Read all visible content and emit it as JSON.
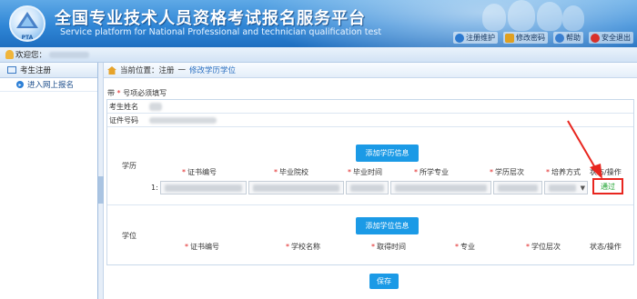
{
  "header": {
    "title_cn": "全国专业技术人员资格考试报名服务平台",
    "title_en": "Service platform for National Professional and technician qualification test",
    "logo_text": "PTA",
    "nav": [
      {
        "label": "注册维护",
        "icon": "person-edit-icon",
        "color": "#2b79d0"
      },
      {
        "label": "修改密码",
        "icon": "lock-icon",
        "color": "#e0a020"
      },
      {
        "label": "帮助",
        "icon": "help-icon",
        "color": "#3a7fd0"
      },
      {
        "label": "安全退出",
        "icon": "power-icon",
        "color": "#d8302a"
      }
    ]
  },
  "welcome": {
    "label": "欢迎您："
  },
  "sidebar": {
    "header": "考生注册",
    "items": [
      {
        "label": "进入网上报名"
      }
    ]
  },
  "breadcrumb": {
    "prefix": "当前位置：",
    "section": "注册",
    "separator": "一",
    "current": "修改学历学位"
  },
  "form": {
    "required_note_prefix": "带",
    "required_note_star": "*",
    "required_note_suffix": "号项必须填写",
    "name_label": "考生姓名",
    "id_label": "证件号码",
    "education": {
      "label": "学历",
      "add_button": "添加学历信息",
      "columns": [
        {
          "label": "证书编号",
          "required": true
        },
        {
          "label": "毕业院校",
          "required": true
        },
        {
          "label": "毕业时间",
          "required": true
        },
        {
          "label": "所学专业",
          "required": true
        },
        {
          "label": "学历层次",
          "required": true
        },
        {
          "label": "培养方式",
          "required": true
        },
        {
          "label": "状态/操作",
          "required": false
        }
      ],
      "row_index": "1:",
      "status": "通过"
    },
    "degree": {
      "label": "学位",
      "add_button": "添加学位信息",
      "columns": [
        {
          "label": "证书编号",
          "required": true
        },
        {
          "label": "学校名称",
          "required": true
        },
        {
          "label": "取得时间",
          "required": true
        },
        {
          "label": "专业",
          "required": true
        },
        {
          "label": "学位层次",
          "required": true
        },
        {
          "label": "状态/操作",
          "required": false
        }
      ]
    },
    "save_button": "保存",
    "star": "*"
  },
  "colors": {
    "accent": "#1b9ae6",
    "status_ok": "#1aa12c",
    "highlight": "#e8261f"
  }
}
